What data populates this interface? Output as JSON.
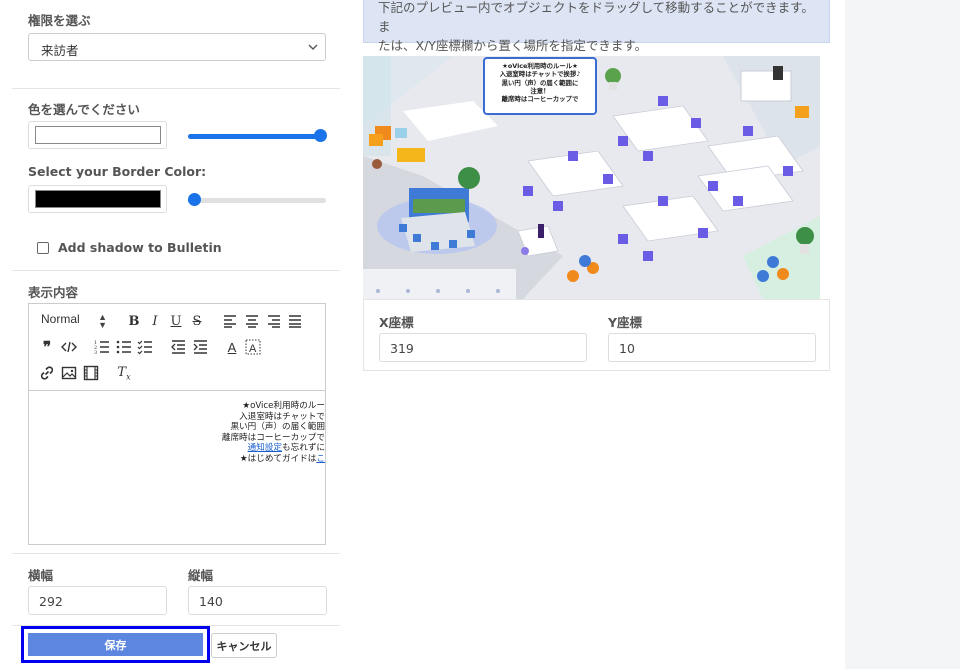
{
  "permission": {
    "label": "権限を選ぶ",
    "selected": "来訪者"
  },
  "color": {
    "label": "色を選んでください",
    "value": "#ffffff",
    "slider_level": 1.0
  },
  "border_color": {
    "label": "Select your Border Color:",
    "value": "#000000",
    "slider_level": 0.0
  },
  "shadow": {
    "label": "Add shadow to Bulletin",
    "checked": false
  },
  "content_section": {
    "label": "表示内容",
    "toolbar": {
      "header_select": "Normal"
    },
    "lines": [
      "★oVice利用時のルー",
      "入退室時はチャットで",
      "黒い円（声）の届く範囲",
      "離席時はコーヒーカップで"
    ],
    "link_text": "通知設定",
    "link_suffix": "も忘れずに",
    "guide_prefix": "★はじめてガイドは",
    "guide_link": "こ"
  },
  "size": {
    "width_label": "横幅",
    "width_value": "292",
    "height_label": "縦幅",
    "height_value": "140"
  },
  "actions": {
    "save": "保存",
    "cancel": "キャンセル"
  },
  "info_text": {
    "line1": "下記のプレビュー内でオブジェクトをドラッグして移動することができます。ま",
    "line2": "たは、X/Y座標欄から置く場所を指定できます。"
  },
  "preview": {
    "bulletin_lines": [
      "★oVice利用時のルール★",
      "入退室時はチャットで挨拶♪",
      "黒い円（声）の届く範囲に",
      "注意！",
      "離席時はコーヒーカップで"
    ]
  },
  "coordinates": {
    "x_label": "X座標",
    "x_value": "319",
    "y_label": "Y座標",
    "y_value": "10"
  },
  "colors": {
    "accent": "#1a73e8",
    "save_button": "#5c86e0",
    "info_bg": "#dde5f5"
  }
}
